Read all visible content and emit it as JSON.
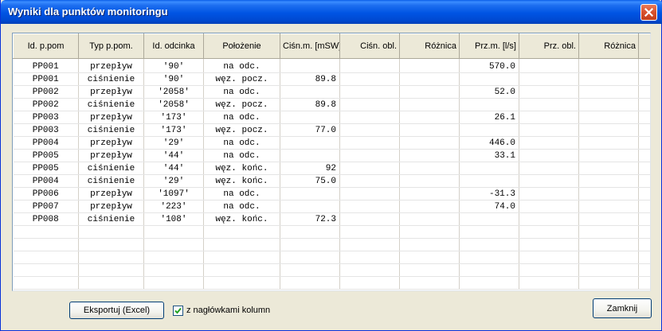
{
  "window": {
    "title": "Wyniki dla punktów monitoringu",
    "close_icon": "close-x-icon"
  },
  "table": {
    "columns": [
      "Id. p.pom",
      "Typ p.pom.",
      "Id. odcinka",
      "Położenie",
      "Ciśn.m. [mSW]",
      "Ciśn. obl.",
      "Różnica",
      "Prz.m. [l/s]",
      "Prz. obl.",
      "Różnica"
    ],
    "rows": [
      [
        "PP001",
        "przepływ",
        "'90'",
        "na odc.",
        "",
        "",
        "",
        "570.0",
        "",
        ""
      ],
      [
        "PP001",
        "ciśnienie",
        "'90'",
        "węz. pocz.",
        "89.8",
        "",
        "",
        "",
        "",
        ""
      ],
      [
        "PP002",
        "przepływ",
        "'2058'",
        "na odc.",
        "",
        "",
        "",
        "52.0",
        "",
        ""
      ],
      [
        "PP002",
        "ciśnienie",
        "'2058'",
        "węz. pocz.",
        "89.8",
        "",
        "",
        "",
        "",
        ""
      ],
      [
        "PP003",
        "przepływ",
        "'173'",
        "na odc.",
        "",
        "",
        "",
        "26.1",
        "",
        ""
      ],
      [
        "PP003",
        "ciśnienie",
        "'173'",
        "węz. pocz.",
        "77.0",
        "",
        "",
        "",
        "",
        ""
      ],
      [
        "PP004",
        "przepływ",
        "'29'",
        "na odc.",
        "",
        "",
        "",
        "446.0",
        "",
        ""
      ],
      [
        "PP005",
        "przepływ",
        "'44'",
        "na odc.",
        "",
        "",
        "",
        "33.1",
        "",
        ""
      ],
      [
        "PP005",
        "ciśnienie",
        "'44'",
        "węz. końc.",
        "92",
        "",
        "",
        "",
        "",
        ""
      ],
      [
        "PP004",
        "ciśnienie",
        "'29'",
        "węz. końc.",
        "75.0",
        "",
        "",
        "",
        "",
        ""
      ],
      [
        "PP006",
        "przepływ",
        "'1097'",
        "na odc.",
        "",
        "",
        "",
        "-31.3",
        "",
        ""
      ],
      [
        "PP007",
        "przepływ",
        "'223'",
        "na odc.",
        "",
        "",
        "",
        "74.0",
        "",
        ""
      ],
      [
        "PP008",
        "ciśnienie",
        "'108'",
        "węz. końc.",
        "72.3",
        "",
        "",
        "",
        "",
        ""
      ]
    ]
  },
  "footer": {
    "export_label": "Eksportuj (Excel)",
    "headers_checkbox_label": "z nagłówkami kolumn",
    "headers_checkbox_checked": true,
    "close_label": "Zamknij"
  }
}
